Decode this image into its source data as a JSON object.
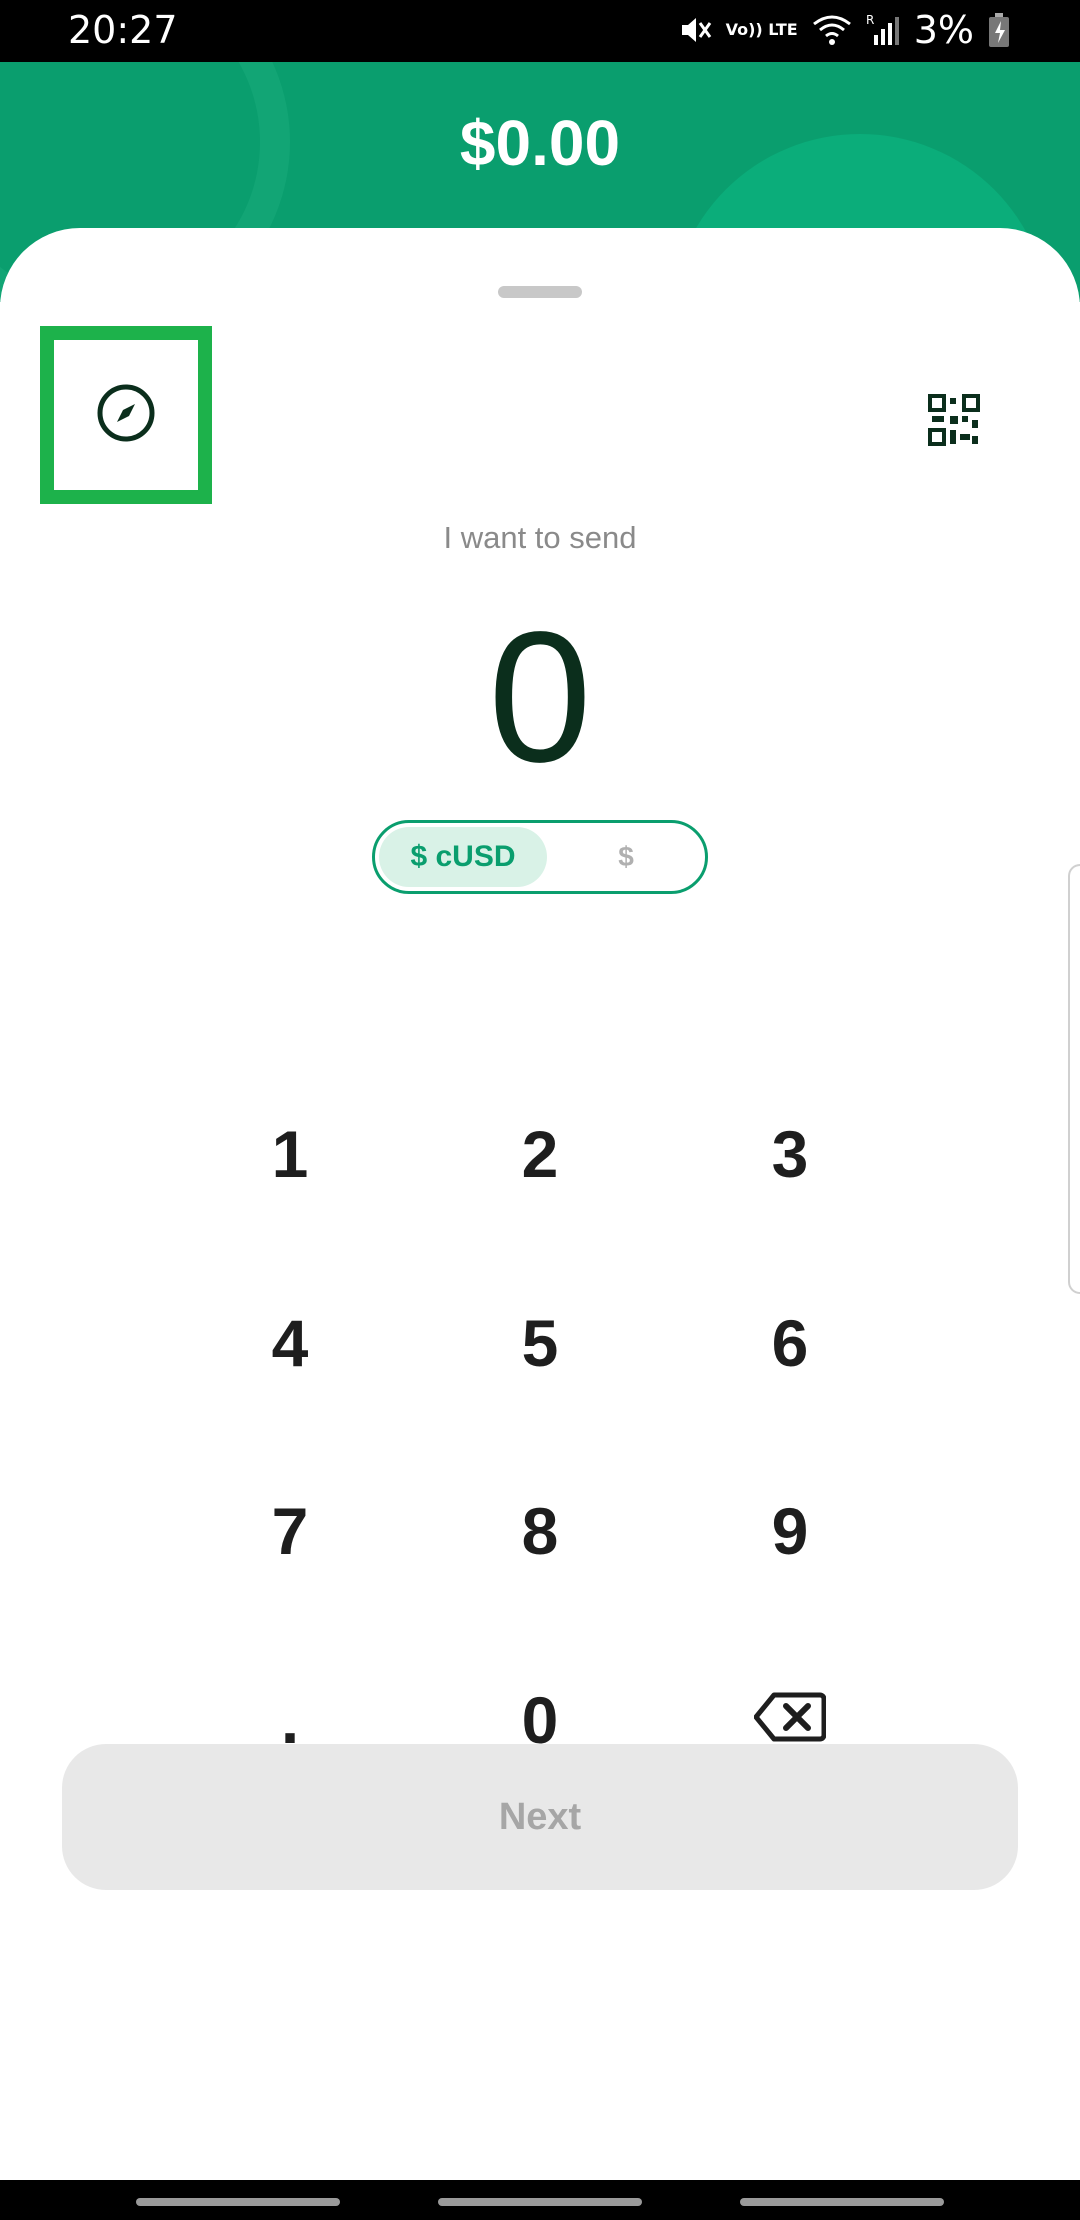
{
  "status_bar": {
    "time": "20:27",
    "volte_label": "Vo)) LTE",
    "roaming_label": "R",
    "battery_percent": "3%"
  },
  "header": {
    "balance": "$0.00"
  },
  "send": {
    "prompt": "I want to send",
    "amount": "0",
    "currency_active": "$ cUSD",
    "currency_inactive": "$"
  },
  "keypad": {
    "keys": [
      "1",
      "2",
      "3",
      "4",
      "5",
      "6",
      "7",
      "8",
      "9",
      ".",
      "0"
    ]
  },
  "actions": {
    "next_label": "Next"
  },
  "icons": [
    "mute-icon",
    "wifi-icon",
    "signal-icon",
    "battery-icon",
    "compass-icon",
    "qr-code-icon",
    "backspace-icon"
  ],
  "colors": {
    "brand_green": "#0a9e6e",
    "highlight_green": "#1db24b",
    "amount_text": "#0b2e1c"
  }
}
